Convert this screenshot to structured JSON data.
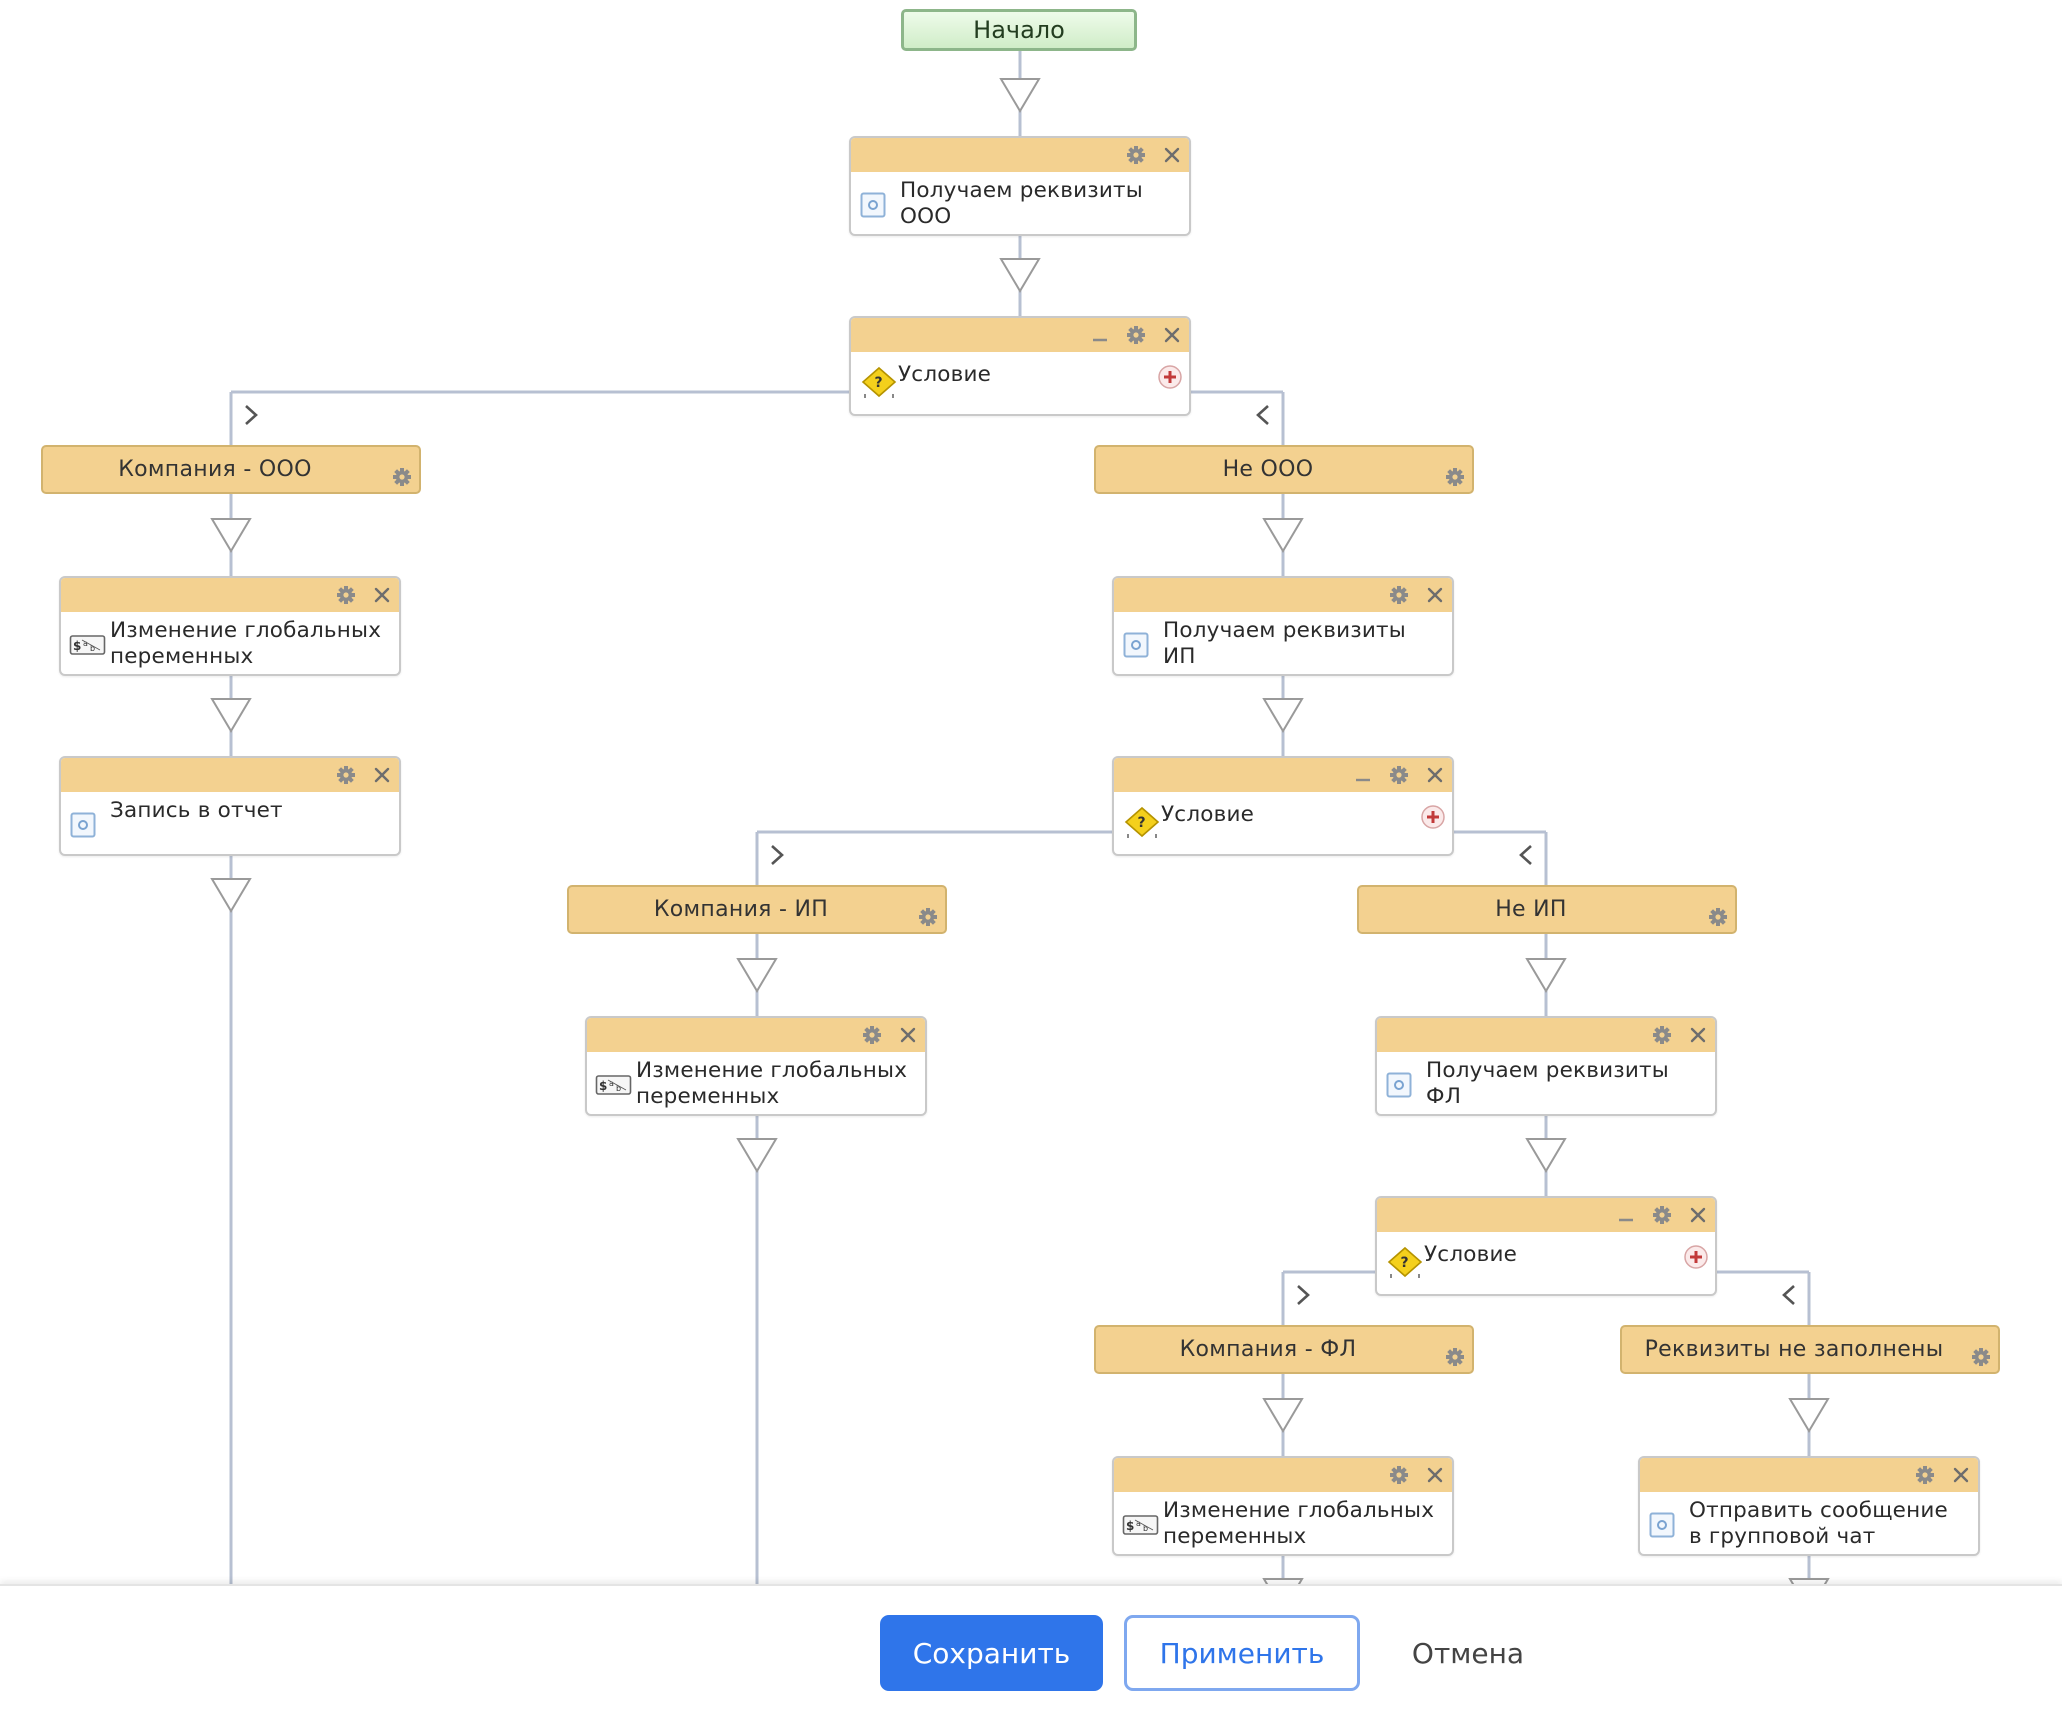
{
  "workflow": {
    "start_label": "Начало",
    "nodes": [
      {
        "id": "n1",
        "kind": "action",
        "icon": "variables-icon",
        "label": "Получаем реквизиты ООО",
        "icon_type": "action"
      },
      {
        "id": "n2",
        "kind": "condition",
        "label": "Условие"
      },
      {
        "id": "n3",
        "kind": "action",
        "icon_type": "variables",
        "label": "Изменение глобальных переменных"
      },
      {
        "id": "n4",
        "kind": "action",
        "icon_type": "action",
        "label": "Запись в отчет"
      },
      {
        "id": "n5",
        "kind": "action",
        "icon_type": "action",
        "label": "Получаем реквизиты ИП"
      },
      {
        "id": "n6",
        "kind": "condition",
        "label": "Условие"
      },
      {
        "id": "n7",
        "kind": "action",
        "icon_type": "variables",
        "label": "Изменение глобальных переменных"
      },
      {
        "id": "n8",
        "kind": "action",
        "icon_type": "action",
        "label": "Получаем реквизиты ФЛ"
      },
      {
        "id": "n9",
        "kind": "condition",
        "label": "Условие"
      },
      {
        "id": "n10",
        "kind": "action",
        "icon_type": "variables",
        "label": "Изменение глобальных переменных"
      },
      {
        "id": "n11",
        "kind": "action",
        "icon_type": "action",
        "label": "Отправить сообщение в групповой чат"
      }
    ],
    "branches": [
      {
        "id": "b1",
        "label": "Компания - ООО"
      },
      {
        "id": "b2",
        "label": "Не ООО"
      },
      {
        "id": "b3",
        "label": "Компания - ИП"
      },
      {
        "id": "b4",
        "label": "Не ИП"
      },
      {
        "id": "b5",
        "label": "Компания - ФЛ"
      },
      {
        "id": "b6",
        "label": "Реквизиты не заполнены"
      }
    ]
  },
  "footer": {
    "save_label": "Сохранить",
    "apply_label": "Применить",
    "cancel_label": "Отмена"
  },
  "colors": {
    "accent": "#2f75ea",
    "block_header": "#f3d190",
    "start_node": "#d0edc8",
    "connector": "#b7c0d2"
  }
}
